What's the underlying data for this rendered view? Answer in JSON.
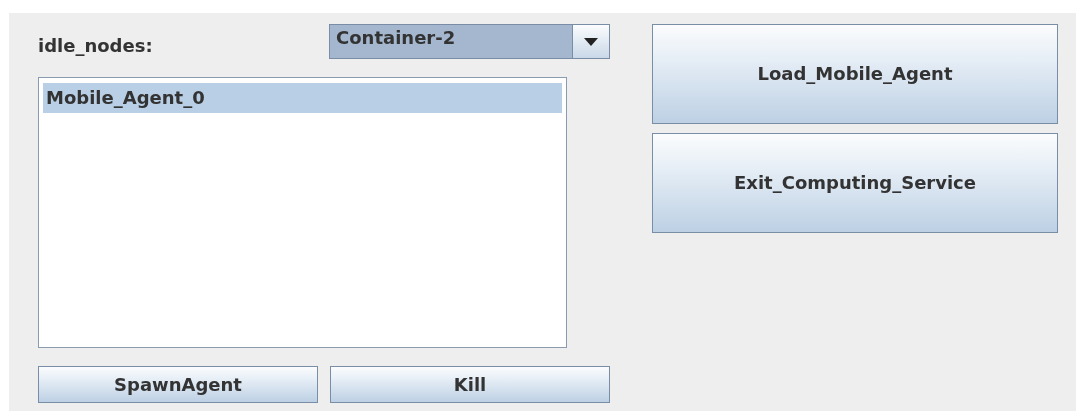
{
  "idle_nodes": {
    "label": "idle_nodes:",
    "value": "Container-2"
  },
  "agents": [
    {
      "name": "Mobile_Agent_0",
      "selected": true
    }
  ],
  "bottom_buttons": [
    "SpawnAgent",
    "Kill"
  ],
  "side_buttons": [
    "Load_Mobile_Agent",
    "Exit_Computing_Service"
  ]
}
